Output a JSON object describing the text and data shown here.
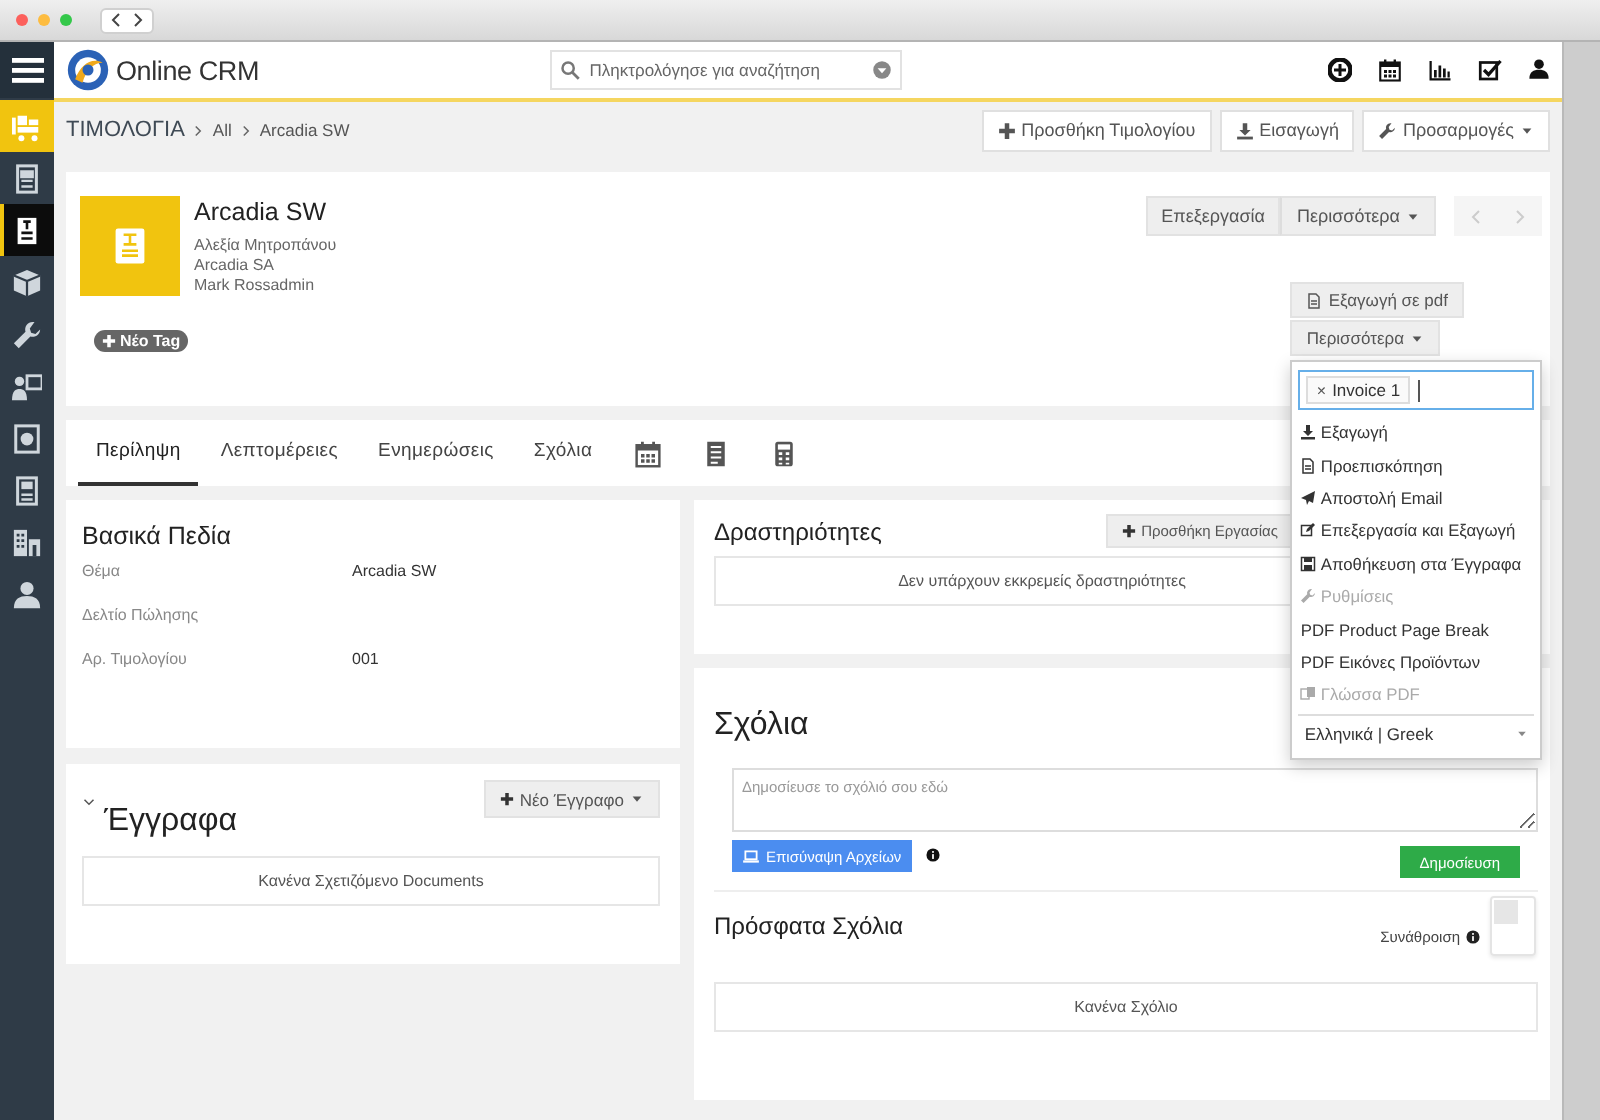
{
  "browser": {
    "traffic_lights": [
      {
        "color": "#fc605c"
      },
      {
        "color": "#fdbc40"
      },
      {
        "color": "#34c84a"
      }
    ]
  },
  "sidebar": {
    "items": [
      {
        "selected": false,
        "active_module": true
      },
      {
        "selected": false,
        "active_module": false
      },
      {
        "selected": true,
        "active_module": false
      },
      {
        "selected": false,
        "active_module": false
      },
      {
        "selected": false,
        "active_module": false
      },
      {
        "selected": false,
        "active_module": false
      },
      {
        "selected": false,
        "active_module": false
      },
      {
        "selected": false,
        "active_module": false
      },
      {
        "selected": false,
        "active_module": false
      },
      {
        "selected": false,
        "active_module": false
      }
    ]
  },
  "header": {
    "logo_text": "Online CRM",
    "search": {
      "placeholder": "Πληκτρολόγησε για αναζήτηση"
    }
  },
  "breadcrumb": [
    "ΤΙΜΟΛΟΓΙΑ",
    "All",
    "Arcadia SW"
  ],
  "toolbar_buttons": [
    {
      "label": "Προσθήκη Τιμολογίου",
      "kind": "add"
    },
    {
      "label": "Εισαγωγή",
      "kind": "import"
    },
    {
      "label": "Προσαρμογές",
      "kind": "customize"
    }
  ],
  "record": {
    "title": "Arcadia SW",
    "details": [
      "Αλεξία Μητροπάνου",
      "Arcadia SA",
      "Mark Rossadmin"
    ],
    "tag_button": "Νέο Tag",
    "edit_button": "Επεξεργασία",
    "more_button": "Περισσότερα",
    "pdf_button": "Εξαγωγή σε pdf",
    "pdf_more_button": "Περισσότερα",
    "pdf_menu": {
      "tag": {
        "remove": "×",
        "label": "Invoice 1"
      },
      "items": [
        {
          "label": "Εξαγωγή",
          "kind": "export",
          "disabled": false
        },
        {
          "label": "Προεπισκόπηση",
          "kind": "preview",
          "disabled": false
        },
        {
          "label": "Αποστολή Email",
          "kind": "email",
          "disabled": false
        },
        {
          "label": "Επεξεργασία και Εξαγωγή",
          "kind": "edit",
          "disabled": false
        },
        {
          "label": "Αποθήκευση στα Έγγραφα",
          "kind": "save",
          "disabled": false
        },
        {
          "label": "Ρυθμίσεις",
          "kind": "settings",
          "disabled": true
        },
        {
          "label": "PDF Product Page Break",
          "kind": "option",
          "disabled": false
        },
        {
          "label": "PDF Εικόνες Προϊόντων",
          "kind": "option",
          "disabled": false
        },
        {
          "label": "Γλώσσα PDF",
          "kind": "language",
          "disabled": true
        }
      ],
      "language": "Ελληνικά | Greek"
    }
  },
  "tabs": [
    {
      "label": "Περίληψη",
      "selected": true
    },
    {
      "label": "Λεπτομέρειες",
      "selected": false
    },
    {
      "label": "Ενημερώσεις",
      "selected": false
    },
    {
      "label": "Σχόλια",
      "selected": false
    }
  ],
  "basic_fields": {
    "title": "Βασικά Πεδία",
    "rows": [
      {
        "label": "Θέμα",
        "value": "Arcadia SW"
      },
      {
        "label": "Δελτίο Πώλησης"
      },
      {
        "label": "Αρ. Τιμολογίου",
        "value": "001"
      }
    ]
  },
  "documents": {
    "title": "Έγγραφα",
    "new_button": "Νέο Έγγραφο",
    "empty_text": "Κανένα Σχετιζόμενο Documents"
  },
  "activities": {
    "title": "Δραστηριότητες",
    "add_button": "Προσθήκη Εργασίας",
    "empty_text": "Δεν υπάρχουν εκκρεμείς δραστηριότητες"
  },
  "comments": {
    "title": "Σχόλια",
    "placeholder": "Δημοσίευσε το σχόλιό σου εδώ",
    "attach_button": "Επισύναψη Αρχείων",
    "publish_button": "Δημοσίευση",
    "recent_title": "Πρόσφατα Σχόλια",
    "aggregate_label": "Συνάθροιση",
    "aggregate_on": false,
    "empty_text": "Κανένα Σχόλιο"
  }
}
